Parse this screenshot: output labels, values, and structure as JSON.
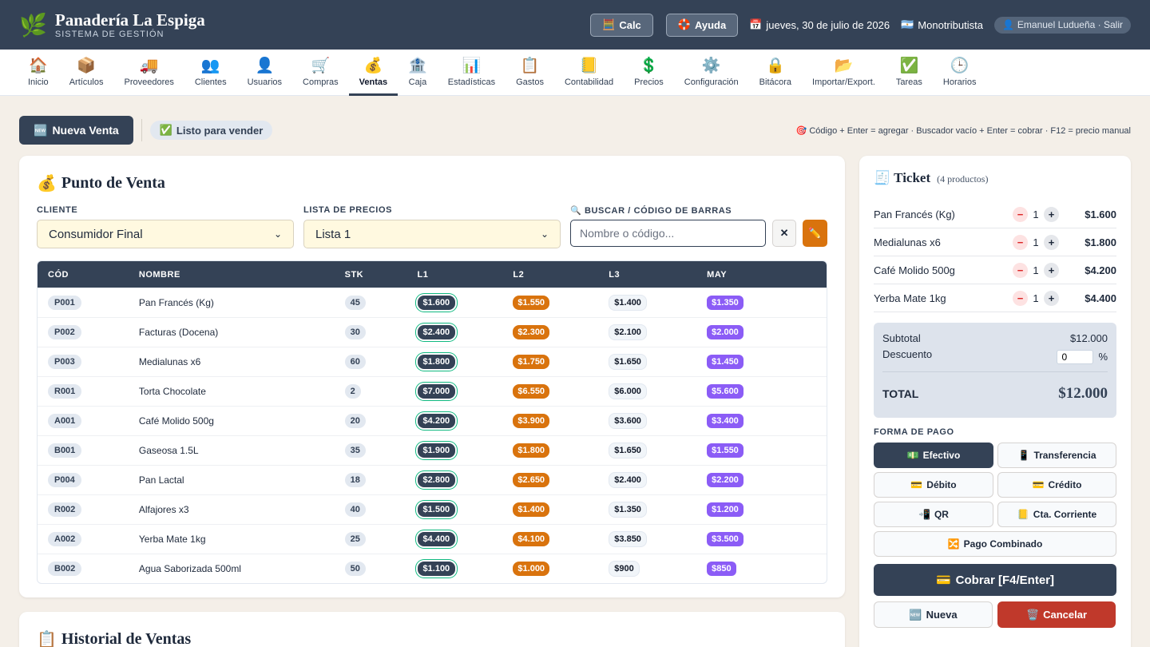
{
  "header": {
    "brand_icon": "🌿",
    "title": "Panadería La Espiga",
    "subtitle": "SISTEMA DE GESTIÓN",
    "calc_icon": "🧮",
    "calc_label": "Calc",
    "help_icon": "🛟",
    "help_label": "Ayuda",
    "date_icon": "📅",
    "date": "jueves, 30 de julio de 2026",
    "plan_icon": "🇦🇷",
    "plan": "Monotributista",
    "user_icon": "👤",
    "user": "Emanuel Ludueña · Salir"
  },
  "nav": [
    {
      "icon": "🏠",
      "label": "Inicio"
    },
    {
      "icon": "📦",
      "label": "Artículos"
    },
    {
      "icon": "🚚",
      "label": "Proveedores"
    },
    {
      "icon": "👥",
      "label": "Clientes"
    },
    {
      "icon": "👤",
      "label": "Usuarios"
    },
    {
      "icon": "🛒",
      "label": "Compras"
    },
    {
      "icon": "💰",
      "label": "Ventas"
    },
    {
      "icon": "🏦",
      "label": "Caja"
    },
    {
      "icon": "📊",
      "label": "Estadísticas"
    },
    {
      "icon": "📋",
      "label": "Gastos"
    },
    {
      "icon": "📒",
      "label": "Contabilidad"
    },
    {
      "icon": "💲",
      "label": "Precios"
    },
    {
      "icon": "⚙️",
      "label": "Configuración"
    },
    {
      "icon": "🔒",
      "label": "Bitácora"
    },
    {
      "icon": "📂",
      "label": "Importar/Export."
    },
    {
      "icon": "✅",
      "label": "Tareas"
    },
    {
      "icon": "🕒",
      "label": "Horarios"
    }
  ],
  "nav_active": "Ventas",
  "actions": {
    "new_sale_icon": "🆕",
    "new_sale_label": "Nueva Venta",
    "ready_icon": "✅",
    "ready_label": "Listo para vender",
    "hint": "🎯 Código + Enter = agregar · Buscador vacío + Enter = cobrar · F12 = precio manual"
  },
  "pos": {
    "title_icon": "💰",
    "title": "Punto de Venta",
    "client_label": "CLIENTE",
    "client_value": "Consumidor Final",
    "pricelist_label": "LISTA DE PRECIOS",
    "pricelist_value": "Lista 1",
    "search_label": "🔍 BUSCAR / CÓDIGO DE BARRAS",
    "search_placeholder": "Nombre o código...",
    "clear_label": "✕",
    "manual_icon": "✏️",
    "columns": [
      "CÓD",
      "NOMBRE",
      "STK",
      "L1",
      "L2",
      "L3",
      "MAY"
    ],
    "products": [
      {
        "cod": "P001",
        "nombre": "Pan Francés (Kg)",
        "stk": "45",
        "l1": "$1.600",
        "l2": "$1.550",
        "l3": "$1.400",
        "may": "$1.350"
      },
      {
        "cod": "P002",
        "nombre": "Facturas (Docena)",
        "stk": "30",
        "l1": "$2.400",
        "l2": "$2.300",
        "l3": "$2.100",
        "may": "$2.000"
      },
      {
        "cod": "P003",
        "nombre": "Medialunas x6",
        "stk": "60",
        "l1": "$1.800",
        "l2": "$1.750",
        "l3": "$1.650",
        "may": "$1.450"
      },
      {
        "cod": "R001",
        "nombre": "Torta Chocolate",
        "stk": "2",
        "l1": "$7.000",
        "l2": "$6.550",
        "l3": "$6.000",
        "may": "$5.600"
      },
      {
        "cod": "A001",
        "nombre": "Café Molido 500g",
        "stk": "20",
        "l1": "$4.200",
        "l2": "$3.900",
        "l3": "$3.600",
        "may": "$3.400"
      },
      {
        "cod": "B001",
        "nombre": "Gaseosa 1.5L",
        "stk": "35",
        "l1": "$1.900",
        "l2": "$1.800",
        "l3": "$1.650",
        "may": "$1.550"
      },
      {
        "cod": "P004",
        "nombre": "Pan Lactal",
        "stk": "18",
        "l1": "$2.800",
        "l2": "$2.650",
        "l3": "$2.400",
        "may": "$2.200"
      },
      {
        "cod": "R002",
        "nombre": "Alfajores x3",
        "stk": "40",
        "l1": "$1.500",
        "l2": "$1.400",
        "l3": "$1.350",
        "may": "$1.200"
      },
      {
        "cod": "A002",
        "nombre": "Yerba Mate 1kg",
        "stk": "25",
        "l1": "$4.400",
        "l2": "$4.100",
        "l3": "$3.850",
        "may": "$3.500"
      },
      {
        "cod": "B002",
        "nombre": "Agua Saborizada 500ml",
        "stk": "50",
        "l1": "$1.100",
        "l2": "$1.000",
        "l3": "$900",
        "may": "$850"
      }
    ]
  },
  "history": {
    "title_icon": "📋",
    "title": "Historial de Ventas"
  },
  "ticket": {
    "title_icon": "🧾",
    "title": "Ticket",
    "count": "(4 productos)",
    "items": [
      {
        "name": "Pan Francés (Kg)",
        "qty": "1",
        "price": "$1.600"
      },
      {
        "name": "Medialunas x6",
        "qty": "1",
        "price": "$1.800"
      },
      {
        "name": "Café Molido 500g",
        "qty": "1",
        "price": "$4.200"
      },
      {
        "name": "Yerba Mate 1kg",
        "qty": "1",
        "price": "$4.400"
      }
    ],
    "subtotal_label": "Subtotal",
    "subtotal": "$12.000",
    "discount_label": "Descuento",
    "discount_value": "0",
    "discount_unit": "%",
    "total_label": "TOTAL",
    "total": "$12.000",
    "payment_label": "FORMA DE PAGO",
    "payments": [
      {
        "icon": "💵",
        "label": "Efectivo"
      },
      {
        "icon": "📱",
        "label": "Transferencia"
      },
      {
        "icon": "💳",
        "label": "Débito"
      },
      {
        "icon": "💳",
        "label": "Crédito"
      },
      {
        "icon": "📲",
        "label": "QR"
      },
      {
        "icon": "📒",
        "label": "Cta. Corriente"
      },
      {
        "icon": "🔀",
        "label": "Pago Combinado"
      }
    ],
    "payment_active": "Efectivo",
    "charge_icon": "💳",
    "charge_label": "Cobrar [F4/Enter]",
    "new_icon": "🆕",
    "new_label": "Nueva",
    "cancel_icon": "🗑️",
    "cancel_label": "Cancelar"
  }
}
